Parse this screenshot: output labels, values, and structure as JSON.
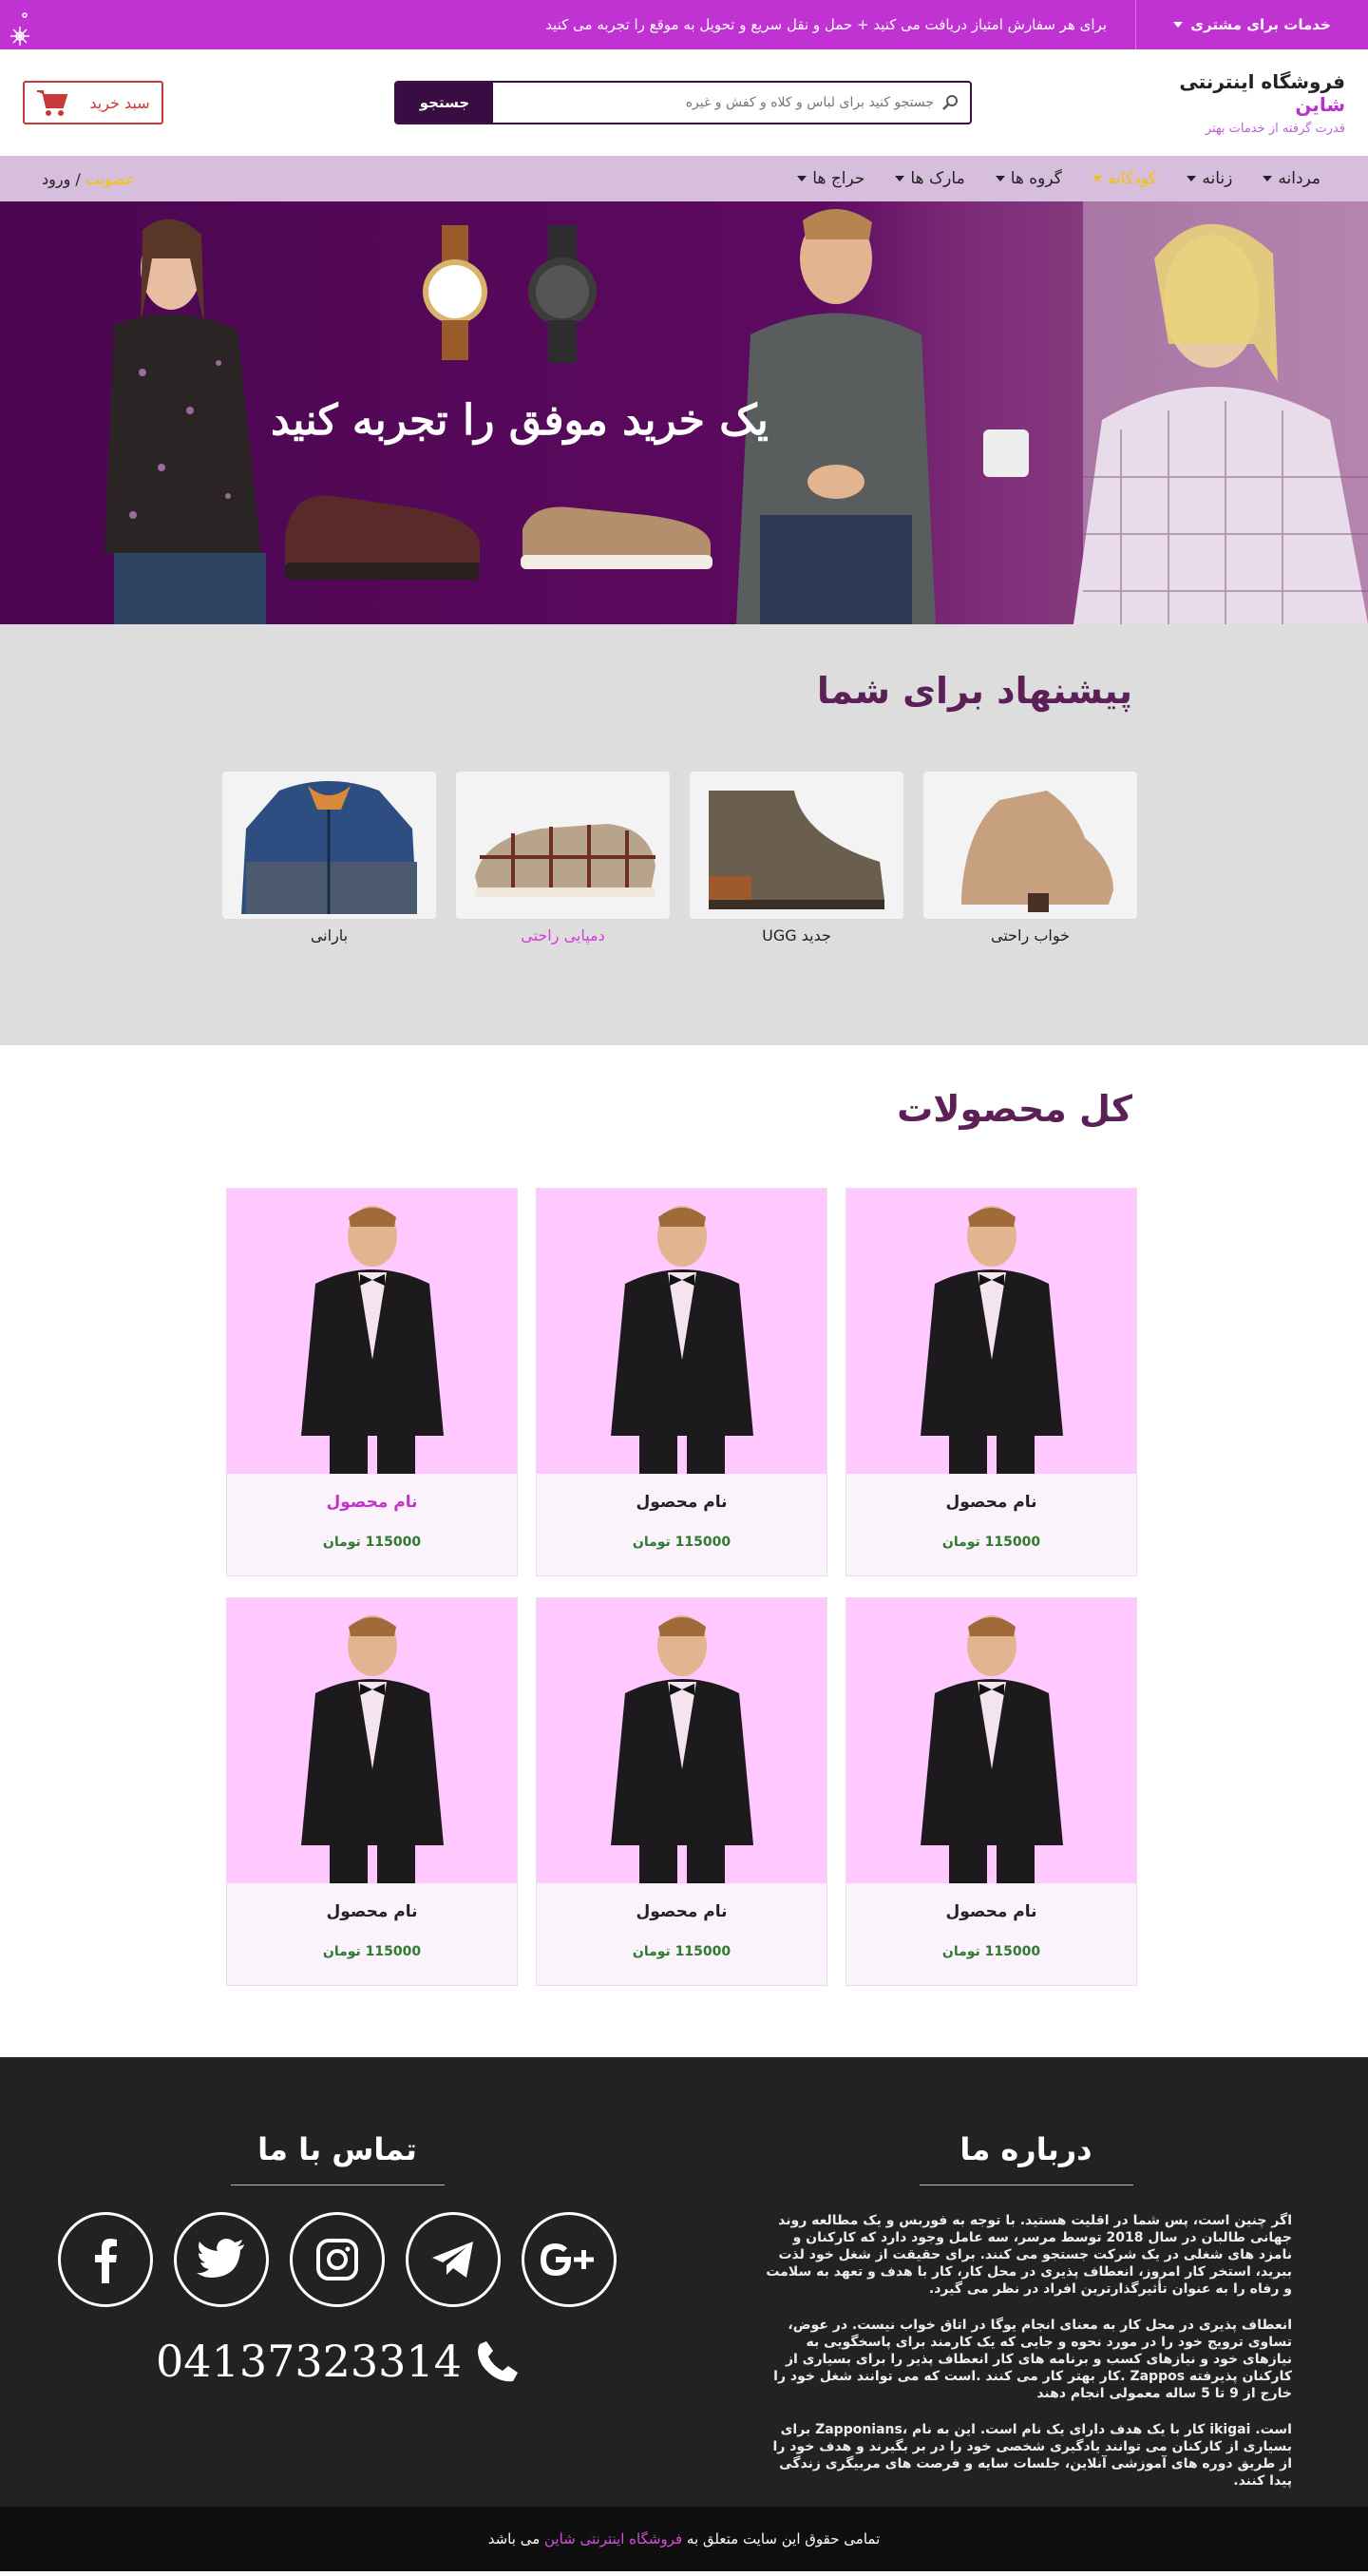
{
  "topbar": {
    "services_label": "خدمات برای مشتری",
    "promo_text": "برای هر سفارش امتیاز دریافت می کنید + حمل و نقل سریع و تحویل به موقع را تجربه می کنید"
  },
  "header": {
    "brand_prefix": "فروشگاه اینترنتی ",
    "brand_name": "شاین",
    "tagline": "قدرت گرفته از خدمات بهتر",
    "search_placeholder": "جستجو کنید برای لباس و کلاه و کفش و غیره",
    "search_button": "جستجو",
    "cart_label": "سبد خرید"
  },
  "nav": {
    "items": [
      {
        "label": "مردانه",
        "dropdown": true
      },
      {
        "label": "زنانه",
        "dropdown": true
      },
      {
        "label": "کودکانه",
        "dropdown": true,
        "active": true
      },
      {
        "label": "گروه ها",
        "dropdown": true
      },
      {
        "label": "مارک ها",
        "dropdown": true
      },
      {
        "label": "حراج ها",
        "dropdown": true
      }
    ],
    "member_label": "عضویت",
    "separator": " / ",
    "login_label": "ورود"
  },
  "hero": {
    "headline": "یک خرید موفق را تجربه کنید"
  },
  "suggestions": {
    "title": "پیشنهاد برای شما",
    "items": [
      {
        "label": "خواب راحتی"
      },
      {
        "label": "جدید UGG"
      },
      {
        "label": "دمپایی راحتی",
        "highlight": true
      },
      {
        "label": "بارانی"
      }
    ]
  },
  "products": {
    "title": "کل محصولات",
    "items": [
      {
        "name": "نام محصول",
        "price": "115000 تومان"
      },
      {
        "name": "نام محصول",
        "price": "115000 تومان"
      },
      {
        "name": "نام محصول",
        "price": "115000 تومان",
        "highlight": true
      },
      {
        "name": "نام محصول",
        "price": "115000 تومان"
      },
      {
        "name": "نام محصول",
        "price": "115000 تومان"
      },
      {
        "name": "نام محصول",
        "price": "115000 تومان"
      }
    ]
  },
  "footer": {
    "about_title": "درباره ما",
    "about_paragraphs": [
      "اگر چنین است، پس شما در اقلیت هستید. با توجه به فوربس و یک مطالعه روند جهانی طالبان در سال 2018 توسط مرسر، سه عامل وجود دارد که کارکنان و نامزد های شغلی در یک شرکت جستجو می کنند. برای حقیقت از شغل خود لذت ببرید، استخر کار امروز، انعطاف پذیری در محل کار، کار با هدف و تعهد به سلامت و رفاه را به عنوان تأثیرگذارترین افراد در نظر می گیرد.",
      "انعطاف پذیری در محل کار به معنای انجام یوگا در اتاق خواب نیست. در عوض، تساوی ترویج خود را در مورد نحوه و جایی که یک کارمند برای پاسخگویی به نیازهای خود و نیازهای کسب و برنامه های کار انعطاف پذیر را برای بسیاری از کارکنان پذیرفته Zappos .کار بهتر کار می کنند .است که می توانند شغل خود را خارج از 9 تا 5 ساله معمولی انجام دهند",
      "است. ikigai کار با یک هدف دارای یک نام است. این به نام ،Zapponians برای بسیاری از کارکنان می توانند یادگیری شخصی خود را در بر بگیرند و هدف خود را از طریق دوره های آموزشی آنلاین، جلسات سایه و فرصت های مربیگری زندگی پیدا کنند."
    ],
    "contact_title": "تماس با ما",
    "socials": [
      {
        "icon": "google-plus-icon"
      },
      {
        "icon": "telegram-icon"
      },
      {
        "icon": "instagram-icon"
      },
      {
        "icon": "twitter-icon"
      },
      {
        "icon": "facebook-icon"
      }
    ],
    "phone": "04137323314",
    "copyright_prefix": "تمامی حقوق این سایت متعلق به ",
    "copyright_brand": "فروشگاه اینترنتی شاین",
    "copyright_suffix": " می باشد"
  }
}
